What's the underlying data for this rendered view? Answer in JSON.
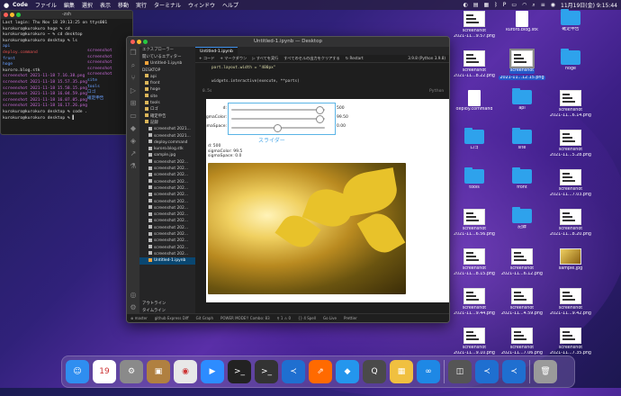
{
  "menubar": {
    "app_name": "Code",
    "items": [
      "ファイル",
      "編集",
      "選択",
      "表示",
      "移動",
      "実行",
      "ターミナル",
      "ウィンドウ",
      "ヘルプ"
    ],
    "clock": "11月19日(金) 9:15:44"
  },
  "terminal": {
    "title": "-zsh",
    "lines": [
      {
        "text": "Last login: Thu Nov 18 19:13:25 on ttys001",
        "color": "plain"
      },
      {
        "text": "kurokuro@kurokuro hoge % cd",
        "color": "plain"
      },
      {
        "text": "kurokuro@kurokuro ~ % cd desktop",
        "color": "plain"
      },
      {
        "text": "kurokuro@kurokuro desktop % ls",
        "color": "plain"
      },
      {
        "text": "api",
        "color": "blue"
      },
      {
        "text": "deploy.command",
        "color": "red"
      },
      {
        "text": "front",
        "color": "blue"
      },
      {
        "text": "hoge",
        "color": "blue"
      },
      {
        "text": "kuroro.blog.stk",
        "color": "plain"
      },
      {
        "text": "screenshot 2021-11-18 7.16.38.png",
        "color": "pink"
      },
      {
        "text": "screenshot 2021-11-18 15.57.35.png",
        "color": "pink"
      },
      {
        "text": "screenshot 2021-11-18 15.58.15.png",
        "color": "pink"
      },
      {
        "text": "screenshot 2021-11-18 16.04.59.png",
        "color": "pink"
      },
      {
        "text": "screenshot 2021-11-18 16.07.05.png",
        "color": "pink"
      },
      {
        "text": "screenshot 2021-11-18 16.17.26.png",
        "color": "pink"
      },
      {
        "text": "kurokuro@kurokuro desktop % code .",
        "color": "plain"
      },
      {
        "text": "kurokuro@kurokuro desktop % ▌",
        "color": "plain"
      }
    ],
    "right_col": [
      "screenshot",
      "screenshot",
      "screenshot",
      "screenshot",
      "screenshot",
      "site",
      "tools",
      "ロゴ",
      "確定申告"
    ]
  },
  "vscode": {
    "title": "Untitled-1.ipynb — Desktop",
    "explorer_header": "エクスプローラー",
    "open_editors": "開いているエディター",
    "tab": "Untitled-1.ipynb",
    "toolbar": [
      "+ コード",
      "+ マークダウン",
      "▷ すべてを実行",
      "すべてのセルの出力をクリアする",
      "↻ Restart"
    ],
    "kernel": "3.9.8 (Python 3.9.8)",
    "code_line1": "part.layout.width = \"400px\"",
    "code_line2": "widgets.interactive(execute, **parts)",
    "lang": "Python",
    "exec_time": "0.5s",
    "tree": [
      {
        "name": "DESKTOP",
        "type": "section"
      },
      {
        "name": "api",
        "type": "folder"
      },
      {
        "name": "front",
        "type": "folder"
      },
      {
        "name": "hoge",
        "type": "folder"
      },
      {
        "name": "site",
        "type": "folder"
      },
      {
        "name": "tools",
        "type": "folder"
      },
      {
        "name": "ロゴ",
        "type": "folder"
      },
      {
        "name": "確定申告",
        "type": "folder"
      },
      {
        "name": "記録",
        "type": "folder"
      },
      {
        "name": "screenshot 2021...",
        "type": "file"
      },
      {
        "name": "screenshot 2021...",
        "type": "file"
      },
      {
        "name": "deploy.command",
        "type": "file"
      },
      {
        "name": "kuroro.blog.stk",
        "type": "file"
      },
      {
        "name": "sample.jpg",
        "type": "file"
      },
      {
        "name": "screenshot 202...",
        "type": "file"
      },
      {
        "name": "screenshot 202...",
        "type": "file"
      },
      {
        "name": "screenshot 202...",
        "type": "file"
      },
      {
        "name": "screenshot 202...",
        "type": "file"
      },
      {
        "name": "screenshot 202...",
        "type": "file"
      },
      {
        "name": "screenshot 202...",
        "type": "file"
      },
      {
        "name": "screenshot 202...",
        "type": "file"
      },
      {
        "name": "screenshot 202...",
        "type": "file"
      },
      {
        "name": "screenshot 202...",
        "type": "file"
      },
      {
        "name": "screenshot 202...",
        "type": "file"
      },
      {
        "name": "screenshot 202...",
        "type": "file"
      },
      {
        "name": "screenshot 202...",
        "type": "file"
      },
      {
        "name": "screenshot 202...",
        "type": "file"
      },
      {
        "name": "screenshot 202...",
        "type": "file"
      },
      {
        "name": "screenshot 202...",
        "type": "file"
      },
      {
        "name": "Untitled-1.ipynb",
        "type": "ipynb"
      }
    ],
    "outline": "アウトライン",
    "timeline": "タイムライン",
    "status": [
      "⊗ master",
      "github Express Diff",
      "Git Graph",
      "POWER MODE!! Combo: 83",
      "⚲ 1 ⚠ 0",
      "{} 4 Spell",
      "Go Live",
      "Prettier"
    ]
  },
  "widgets": {
    "sliders": [
      {
        "label": "d:",
        "value": "500",
        "fraction": 0.97
      },
      {
        "label": "sigmaColor:",
        "value": "99.50",
        "fraction": 0.97
      },
      {
        "label": "sigmaSpace:",
        "value": "0.00",
        "fraction": 0.5
      }
    ],
    "caption": "スライダー",
    "printed": [
      "d: 500",
      "sigmaColor: 99.5",
      "sigmaSpace: 0.0"
    ]
  },
  "desktop_icons": [
    {
      "label1": "screenshot",
      "label2": "2021-11...9.57.png",
      "kind": "thumb"
    },
    {
      "label1": "kuroro.blog.stk",
      "label2": "",
      "kind": "doc"
    },
    {
      "label1": "確定申告",
      "label2": "",
      "kind": "folder"
    },
    {
      "label1": "screenshot",
      "label2": "2021-11...8.22.png",
      "kind": "thumb"
    },
    {
      "label1": "screenshot",
      "label2": "2021-11...12.15.png",
      "kind": "thumb",
      "selected": true
    },
    {
      "label1": "hoge",
      "label2": "",
      "kind": "folder"
    },
    {
      "label1": "deploy.command",
      "label2": "",
      "kind": "doc"
    },
    {
      "label1": "api",
      "label2": "",
      "kind": "folder"
    },
    {
      "label1": "screenshot",
      "label2": "2021-11...6.14.png",
      "kind": "thumb"
    },
    {
      "label1": "ロゴ",
      "label2": "",
      "kind": "folder"
    },
    {
      "label1": "site",
      "label2": "",
      "kind": "folder"
    },
    {
      "label1": "screenshot",
      "label2": "2021-11...5.28.png",
      "kind": "thumb"
    },
    {
      "label1": "tools",
      "label2": "",
      "kind": "folder"
    },
    {
      "label1": "front",
      "label2": "",
      "kind": "folder"
    },
    {
      "label1": "screenshot",
      "label2": "2021-11...7.03.png",
      "kind": "thumb"
    },
    {
      "label1": "screenshot",
      "label2": "2021-11...6.56.png",
      "kind": "thumb"
    },
    {
      "label1": "記録",
      "label2": "",
      "kind": "folder"
    },
    {
      "label1": "screenshot",
      "label2": "2021-11...8.20.png",
      "kind": "thumb"
    },
    {
      "label1": "screenshot",
      "label2": "2021-11...8.15.png",
      "kind": "thumb"
    },
    {
      "label1": "screenshot",
      "label2": "2021-11...6.12.png",
      "kind": "thumb"
    },
    {
      "label1": "sample.jpg",
      "label2": "",
      "kind": "photo"
    },
    {
      "label1": "screenshot",
      "label2": "2021-11...9.44.png",
      "kind": "thumb"
    },
    {
      "label1": "screenshot",
      "label2": "2021-11...4.59.png",
      "kind": "thumb"
    },
    {
      "label1": "screenshot",
      "label2": "2021-11...9.42.png",
      "kind": "thumb"
    },
    {
      "label1": "screenshot",
      "label2": "2021-11...9.10.png",
      "kind": "thumb"
    },
    {
      "label1": "screenshot",
      "label2": "2021-11...7.06.png",
      "kind": "thumb"
    },
    {
      "label1": "screenshot",
      "label2": "2021-11...7.35.png",
      "kind": "thumb"
    }
  ],
  "dock": [
    {
      "name": "Finder",
      "color": "#2f8ef0",
      "glyph": "☺"
    },
    {
      "name": "Calendar",
      "color": "#ffffff",
      "glyph": "19"
    },
    {
      "name": "System Preferences",
      "color": "#8a8a8a",
      "glyph": "⚙"
    },
    {
      "name": "Contacts",
      "color": "#b08040",
      "glyph": "▣"
    },
    {
      "name": "Chrome",
      "color": "#e8e8e8",
      "glyph": "◉"
    },
    {
      "name": "Zoom",
      "color": "#2d8cff",
      "glyph": "▶"
    },
    {
      "name": "Terminal",
      "color": "#222222",
      "glyph": ">_"
    },
    {
      "name": "Terminal2",
      "color": "#333333",
      "glyph": ">_"
    },
    {
      "name": "VS Code",
      "color": "#1f6fd0",
      "glyph": "≺"
    },
    {
      "name": "Stats",
      "color": "#ff6a00",
      "glyph": "⇗"
    },
    {
      "name": "Docker",
      "color": "#2496ed",
      "glyph": "◆"
    },
    {
      "name": "QuickTime",
      "color": "#4a4a4a",
      "glyph": "Q"
    },
    {
      "name": "Preview",
      "color": "#f0c040",
      "glyph": "▦"
    },
    {
      "name": "Infinity",
      "color": "#1e88e5",
      "glyph": "∞"
    },
    {
      "name": "Screenshot",
      "color": "#555555",
      "glyph": "◫"
    },
    {
      "name": "VS Code 2",
      "color": "#1f6fd0",
      "glyph": "≺"
    },
    {
      "name": "VS Code 3",
      "color": "#1f6fd0",
      "glyph": "≺"
    },
    {
      "name": "Trash",
      "color": "#9a9a9a",
      "glyph": "🗑"
    }
  ]
}
